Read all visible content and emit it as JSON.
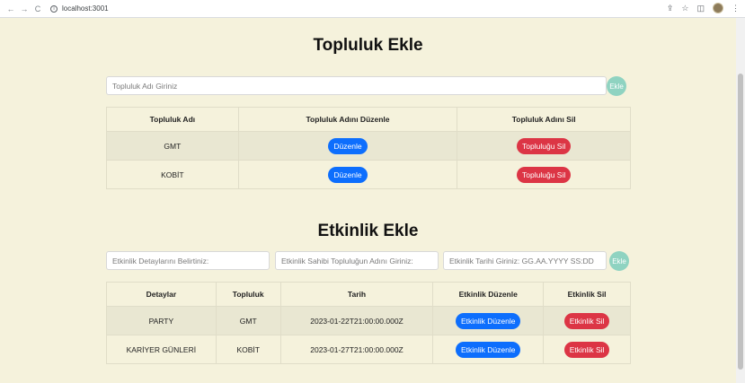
{
  "browser": {
    "url": "localhost:3001",
    "back": "←",
    "forward": "→",
    "reload": "C",
    "info": "i",
    "share": "⇪",
    "star": "☆",
    "sidepanel": "◫",
    "menu": "⋮"
  },
  "topluluk": {
    "title": "Topluluk Ekle",
    "input_placeholder": "Topluluk Adı Giriniz",
    "add_label": "Ekle",
    "headers": [
      "Topluluk Adı",
      "Topluluk Adını Düzenle",
      "Topluluk Adını Sil"
    ],
    "rows": [
      {
        "name": "GMT",
        "edit": "Düzenle",
        "delete": "Topluluğu Sil"
      },
      {
        "name": "KOBİT",
        "edit": "Düzenle",
        "delete": "Topluluğu Sil"
      }
    ]
  },
  "etkinlik": {
    "title": "Etkinlik Ekle",
    "detail_placeholder": "Etkinlik Detaylarını Belirtiniz:",
    "owner_placeholder": "Etkinlik Sahibi Topluluğun Adını Giriniz:",
    "date_placeholder": "Etkinlik Tarihi Giriniz: GG.AA.YYYY SS:DD",
    "add_label": "Ekle",
    "headers": [
      "Detaylar",
      "Topluluk",
      "Tarih",
      "Etkinlik Düzenle",
      "Etkinlik Sil"
    ],
    "rows": [
      {
        "detail": "PARTY",
        "community": "GMT",
        "date": "2023-01-22T21:00:00.000Z",
        "edit": "Etkinlik Düzenle",
        "delete": "Etkinlik Sil"
      },
      {
        "detail": "KARİYER GÜNLERİ",
        "community": "KOBİT",
        "date": "2023-01-27T21:00:00.000Z",
        "edit": "Etkinlik Düzenle",
        "delete": "Etkinlik Sil"
      }
    ]
  },
  "colors": {
    "background": "#f5f2dc",
    "primary": "#0d6efd",
    "danger": "#dc3545",
    "add": "#8fd3c1"
  }
}
